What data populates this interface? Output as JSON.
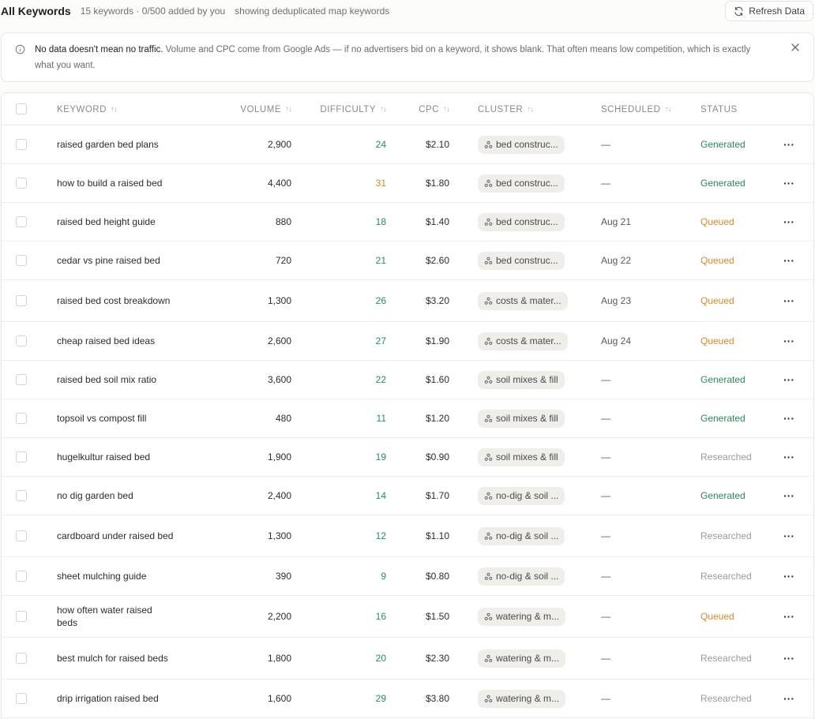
{
  "header": {
    "title": "All Keywords",
    "meta": "15 keywords · 0/500 added by you",
    "meta2": "showing deduplicated map keywords",
    "refresh_label": "Refresh Data"
  },
  "notice": {
    "bold": "No data doesn't mean no traffic.",
    "text": " Volume and CPC come from Google Ads — if no advertisers bid on a keyword, it shows blank. That often means low competition, which is exactly what you want."
  },
  "columns": {
    "keyword": "KEYWORD",
    "volume": "VOLUME",
    "difficulty": "DIFFICULTY",
    "cpc": "CPC",
    "cluster": "CLUSTER",
    "scheduled": "SCHEDULED",
    "status": "STATUS",
    "sort_glyph": "↑↓"
  },
  "rows": [
    {
      "keyword": "raised garden bed plans",
      "volume": "2,900",
      "difficulty": "24",
      "diff_level": "green",
      "cpc": "$2.10",
      "cluster": "bed construc...",
      "scheduled": "—",
      "status": "Generated"
    },
    {
      "keyword": "how to build a raised bed",
      "volume": "4,400",
      "difficulty": "31",
      "diff_level": "orange",
      "cpc": "$1.80",
      "cluster": "bed construc...",
      "scheduled": "—",
      "status": "Generated"
    },
    {
      "keyword": "raised bed height guide",
      "volume": "880",
      "difficulty": "18",
      "diff_level": "green",
      "cpc": "$1.40",
      "cluster": "bed construc...",
      "scheduled": "Aug 21",
      "status": "Queued"
    },
    {
      "keyword": "cedar vs pine raised bed",
      "volume": "720",
      "difficulty": "21",
      "diff_level": "green",
      "cpc": "$2.60",
      "cluster": "bed construc...",
      "scheduled": "Aug 22",
      "status": "Queued"
    },
    {
      "keyword": "raised bed cost breakdown",
      "volume": "1,300",
      "difficulty": "26",
      "diff_level": "green",
      "cpc": "$3.20",
      "cluster": "costs & mater...",
      "scheduled": "Aug 23",
      "status": "Queued"
    },
    {
      "keyword": "cheap raised bed ideas",
      "volume": "2,600",
      "difficulty": "27",
      "diff_level": "green",
      "cpc": "$1.90",
      "cluster": "costs & mater...",
      "scheduled": "Aug 24",
      "status": "Queued"
    },
    {
      "keyword": "raised bed soil mix ratio",
      "volume": "3,600",
      "difficulty": "22",
      "diff_level": "green",
      "cpc": "$1.60",
      "cluster": "soil mixes & fill",
      "scheduled": "—",
      "status": "Generated"
    },
    {
      "keyword": "topsoil vs compost fill",
      "volume": "480",
      "difficulty": "11",
      "diff_level": "green",
      "cpc": "$1.20",
      "cluster": "soil mixes & fill",
      "scheduled": "—",
      "status": "Generated"
    },
    {
      "keyword": "hugelkultur raised bed",
      "volume": "1,900",
      "difficulty": "19",
      "diff_level": "green",
      "cpc": "$0.90",
      "cluster": "soil mixes & fill",
      "scheduled": "—",
      "status": "Researched"
    },
    {
      "keyword": "no dig garden bed",
      "volume": "2,400",
      "difficulty": "14",
      "diff_level": "green",
      "cpc": "$1.70",
      "cluster": "no-dig & soil ...",
      "scheduled": "—",
      "status": "Generated"
    },
    {
      "keyword": "cardboard under raised bed",
      "volume": "1,300",
      "difficulty": "12",
      "diff_level": "green",
      "cpc": "$1.10",
      "cluster": "no-dig & soil ...",
      "scheduled": "—",
      "status": "Researched"
    },
    {
      "keyword": "sheet mulching guide",
      "volume": "390",
      "difficulty": "9",
      "diff_level": "green",
      "cpc": "$0.80",
      "cluster": "no-dig & soil ...",
      "scheduled": "—",
      "status": "Researched"
    },
    {
      "keyword": "how often water raised beds",
      "volume": "2,200",
      "difficulty": "16",
      "diff_level": "green",
      "cpc": "$1.50",
      "cluster": "watering & m...",
      "scheduled": "—",
      "status": "Queued"
    },
    {
      "keyword": "best mulch for raised beds",
      "volume": "1,800",
      "difficulty": "20",
      "diff_level": "green",
      "cpc": "$2.30",
      "cluster": "watering & m...",
      "scheduled": "—",
      "status": "Researched"
    },
    {
      "keyword": "drip irrigation raised bed",
      "volume": "1,600",
      "difficulty": "29",
      "diff_level": "green",
      "cpc": "$3.80",
      "cluster": "watering & m...",
      "scheduled": "—",
      "status": "Researched"
    }
  ],
  "row_action_glyph": "···",
  "colors": {
    "green": "#2b8a5a",
    "orange": "#d4892a",
    "muted": "#9a9a94"
  }
}
